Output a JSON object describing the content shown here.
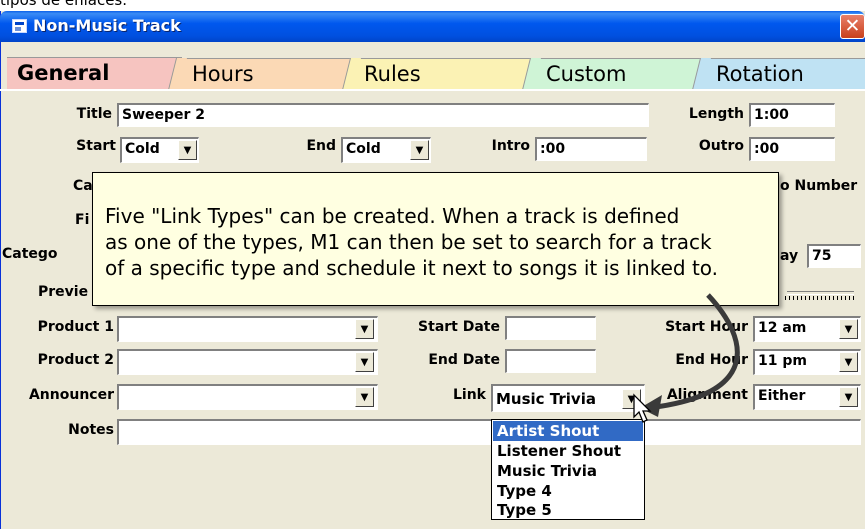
{
  "page": {
    "remnant_text": "tipos de enlaces."
  },
  "window": {
    "title": "Non-Music Track",
    "close_glyph": "✕"
  },
  "tabs": [
    {
      "label": "General",
      "color": "#f6c4c0",
      "active": true
    },
    {
      "label": "Hours",
      "color": "#fbd9b5"
    },
    {
      "label": "Rules",
      "color": "#fbf2b4"
    },
    {
      "label": "Custom",
      "color": "#cff4d6"
    },
    {
      "label": "Rotation",
      "color": "#bfe2f3"
    }
  ],
  "form": {
    "title_label": "Title",
    "title_value": "Sweeper 2",
    "length_label": "Length",
    "length_value": "1:00",
    "start_label": "Start",
    "start_value": "Cold",
    "end_label": "End",
    "end_value": "Cold",
    "intro_label": "Intro",
    "intro_value": ":00",
    "outro_label": "Outro",
    "outro_value": ":00",
    "row3_left_label": "Ca",
    "row3_right_label": "o Number",
    "row4_left_label": "Fi",
    "row5_left_label": "Catego",
    "row5_right_label": "ay",
    "row5_right_value": "75",
    "row6_left_label": "Previe",
    "product1_label": "Product 1",
    "product1_value": "",
    "product2_label": "Product 2",
    "product2_value": "",
    "announcer_label": "Announcer",
    "announcer_value": "",
    "start_date_label": "Start Date",
    "start_date_value": "",
    "end_date_label": "End Date",
    "end_date_value": "",
    "link_label": "Link",
    "link_value": "Music Trivia",
    "start_hour_label": "Start Hour",
    "start_hour_value": "12 am",
    "end_hour_label": "End Hour",
    "end_hour_value": "11 pm",
    "alignment_label": "Alignment",
    "alignment_value": "Either",
    "notes_label": "Notes",
    "notes_value": ""
  },
  "tooltip": {
    "text": "Five \"Link Types\" can be created.  When a track is defined\nas one of the types, M1 can then be set to search for a track\nof a specific type and schedule it next to songs it is linked to."
  },
  "link_options": [
    "Artist Shout",
    "Listener Shout",
    "Music Trivia",
    "Type 4",
    "Type 5"
  ],
  "link_selected_index": 0,
  "icons": {
    "dropdown": "▼"
  },
  "colors": {
    "titlebar": "#0058ee",
    "selection": "#316ac5",
    "tooltip_bg": "#ffffe1",
    "arrow": "#3a3a3a"
  }
}
